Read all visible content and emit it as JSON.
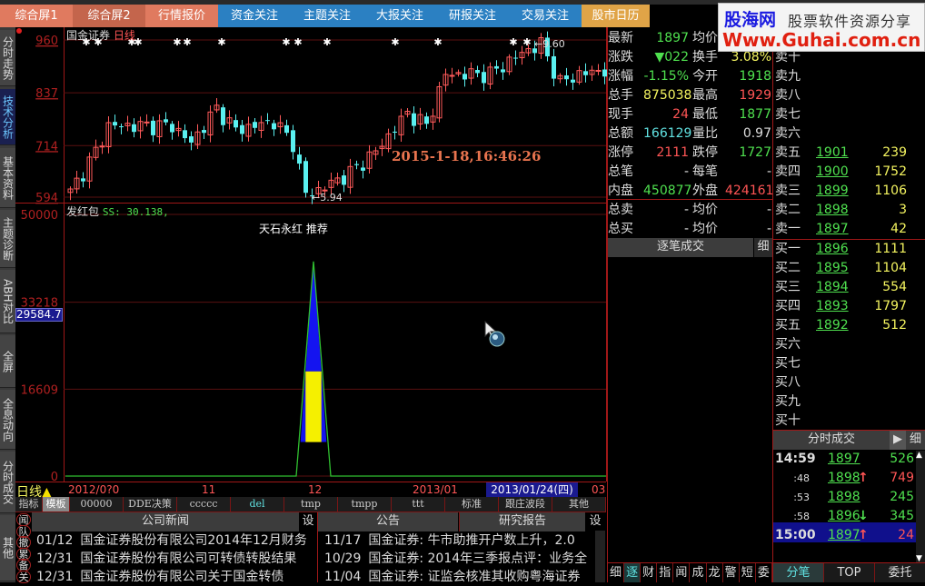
{
  "top_tabs": [
    {
      "label": "综合屏1",
      "color": "#e07a5f"
    },
    {
      "label": "综合屏2",
      "color": "#c4654c"
    },
    {
      "label": "行情报价",
      "color": "#e07a5f"
    },
    {
      "label": "资金关注",
      "color": "#2b80c2"
    },
    {
      "label": "主题关注",
      "color": "#2b80c2"
    },
    {
      "label": "大报关注",
      "color": "#2b80c2"
    },
    {
      "label": "研报关注",
      "color": "#2b80c2"
    },
    {
      "label": "交易关注",
      "color": "#2b80c2"
    },
    {
      "label": "股市日历",
      "color": "#e0a447"
    }
  ],
  "watermark": {
    "brand": "股海网",
    "slogan": "股票软件资源分享",
    "url": "Www.Guhai.com.cn"
  },
  "side_tabs": [
    "分时走势",
    "技术分析",
    "基本资料",
    "主题诊断",
    "ABH对比",
    "全屏",
    "全息动向",
    "分时成交",
    "其他"
  ],
  "chart": {
    "stock_name": "国金证券",
    "period": "日线",
    "price_axis": [
      "960",
      "837",
      "714",
      "594"
    ],
    "high_marker": "9.60",
    "low_marker": "5.94",
    "timestamp": "2015-1-18,16:46:26",
    "price_path": [
      [
        0,
        605
      ],
      [
        4,
        700
      ],
      [
        6,
        760
      ],
      [
        16,
        760
      ],
      [
        19,
        720
      ],
      [
        23,
        800
      ],
      [
        26,
        750
      ],
      [
        32,
        770
      ],
      [
        35,
        720
      ],
      [
        37,
        600
      ],
      [
        39,
        610
      ],
      [
        44,
        650
      ],
      [
        48,
        700
      ],
      [
        53,
        790
      ],
      [
        56,
        760
      ],
      [
        59,
        880
      ],
      [
        66,
        880
      ],
      [
        71,
        930
      ],
      [
        74,
        950
      ],
      [
        77,
        860
      ],
      [
        80,
        880
      ],
      [
        84,
        890
      ]
    ]
  },
  "indicator": {
    "name": "发红包",
    "ss_label": "SS: 30.138,",
    "title": "天石永红  推荐",
    "axis": [
      "50000",
      "33218",
      "16609",
      "0"
    ],
    "cursor_value": "29584.7",
    "peak_value": 41000,
    "blue_to": 20000,
    "yellow_to": 6500
  },
  "date_axis": {
    "period": "日线",
    "labels": [
      "2012/0?0",
      "11",
      "12",
      "2013/01",
      "03"
    ],
    "selected_date": "2013/01/24(四)"
  },
  "indicator_tabs": [
    "指标",
    "模板",
    "00000",
    "DDE决策",
    "ccccc",
    "del",
    "tmp",
    "tmpp",
    "ttt",
    "标准",
    "跟庄波段",
    "其他"
  ],
  "news": {
    "icons": [
      "闻",
      "队",
      "撤",
      "累",
      "备",
      "关"
    ],
    "company_news_title": "公司新闻",
    "settings": "设",
    "announcement_title": "公告",
    "research_title": "研究报告",
    "company_news": [
      {
        "date": "01/12",
        "title": "国金证券股份有限公司2014年12月财务"
      },
      {
        "date": "12/31",
        "title": "国金证券股份有限公司可转债转股结果"
      },
      {
        "date": "12/31",
        "title": "国金证券股份有限公司关于国金转债"
      }
    ],
    "reports": [
      {
        "date": "11/17",
        "title": "国金证券: 牛市助推开户数上升，2.0"
      },
      {
        "date": "10/29",
        "title": "国金证券: 2014年三季报点评：业务全"
      },
      {
        "date": "11/04",
        "title": "国金证券: 证监会核准其收购粤海证券"
      }
    ]
  },
  "quote": [
    {
      "l1": "最新",
      "v1": "1897",
      "c1": "g",
      "l2": "均价",
      "v2": "",
      "c2": "w"
    },
    {
      "l1": "涨跌",
      "v1": "▼022",
      "c1": "g",
      "l2": "换手",
      "v2": "3.08%",
      "c2": "y"
    },
    {
      "l1": "涨幅",
      "v1": "-1.15%",
      "c1": "g",
      "l2": "今开",
      "v2": "1918",
      "c2": "g"
    },
    {
      "l1": "总手",
      "v1": "875038",
      "c1": "y",
      "l2": "最高",
      "v2": "1929",
      "c2": "r"
    },
    {
      "l1": "现手",
      "v1": "24",
      "c1": "r",
      "l2": "最低",
      "v2": "1877",
      "c2": "g"
    },
    {
      "l1": "总额",
      "v1": "166129",
      "c1": "c",
      "l2": "量比",
      "v2": "0.97",
      "c2": "w"
    },
    {
      "l1": "涨停",
      "v1": "2111",
      "c1": "r",
      "l2": "跌停",
      "v2": "1727",
      "c2": "g"
    },
    {
      "l1": "总笔",
      "v1": "-",
      "c1": "w",
      "l2": "每笔",
      "v2": "-",
      "c2": "w"
    },
    {
      "l1": "内盘",
      "v1": "450877",
      "c1": "g",
      "l2": "外盘",
      "v2": "424161",
      "c2": "r"
    },
    {
      "l1": "总卖",
      "v1": "-",
      "c1": "w",
      "l2": "均价",
      "v2": "-",
      "c2": "w"
    },
    {
      "l1": "总买",
      "v1": "-",
      "c1": "w",
      "l2": "均价",
      "v2": "-",
      "c2": "w"
    }
  ],
  "tick_panel": {
    "title": "逐笔成交",
    "detail": "细"
  },
  "order_book": {
    "asks": [
      {
        "label": "卖十",
        "price": "",
        "vol": ""
      },
      {
        "label": "卖九",
        "price": "",
        "vol": ""
      },
      {
        "label": "卖八",
        "price": "",
        "vol": ""
      },
      {
        "label": "卖七",
        "price": "",
        "vol": ""
      },
      {
        "label": "卖六",
        "price": "",
        "vol": ""
      },
      {
        "label": "卖五",
        "price": "1901",
        "vol": "239"
      },
      {
        "label": "卖四",
        "price": "1900",
        "vol": "1752"
      },
      {
        "label": "卖三",
        "price": "1899",
        "vol": "1106"
      },
      {
        "label": "卖二",
        "price": "1898",
        "vol": "3"
      },
      {
        "label": "卖一",
        "price": "1897",
        "vol": "42"
      }
    ],
    "bids": [
      {
        "label": "买一",
        "price": "1896",
        "vol": "1111"
      },
      {
        "label": "买二",
        "price": "1895",
        "vol": "1104"
      },
      {
        "label": "买三",
        "price": "1894",
        "vol": "554"
      },
      {
        "label": "买四",
        "price": "1893",
        "vol": "1797"
      },
      {
        "label": "买五",
        "price": "1892",
        "vol": "512"
      },
      {
        "label": "买六",
        "price": "",
        "vol": ""
      },
      {
        "label": "买七",
        "price": "",
        "vol": ""
      },
      {
        "label": "买八",
        "price": "",
        "vol": ""
      },
      {
        "label": "买九",
        "price": "",
        "vol": ""
      },
      {
        "label": "买十",
        "price": "",
        "vol": ""
      }
    ]
  },
  "trades": {
    "title": "分时成交",
    "detail": "细",
    "rows": [
      {
        "time": "14:59",
        "price": "1897",
        "arrow": "",
        "vol": "526",
        "vc": "g"
      },
      {
        "time": ":48",
        "price": "1898",
        "arrow": "↑",
        "vol": "749",
        "vc": "r"
      },
      {
        "time": ":53",
        "price": "1898",
        "arrow": "",
        "vol": "245",
        "vc": "g"
      },
      {
        "time": ":58",
        "price": "1896",
        "arrow": "↓",
        "vol": "345",
        "vc": "g"
      },
      {
        "time": "15:00",
        "price": "1897",
        "arrow": "↑",
        "vol": "24",
        "vc": "r"
      }
    ]
  },
  "bottom_tabs_left": [
    "细",
    "逐",
    "财",
    "指",
    "闻",
    "成",
    "龙",
    "警",
    "短",
    "委"
  ],
  "bottom_tabs_right": [
    "分笔",
    "TOP",
    "委托"
  ]
}
